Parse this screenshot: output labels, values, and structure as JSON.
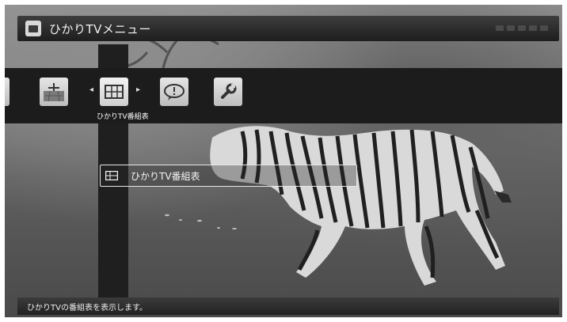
{
  "header": {
    "title": "ひかりTVメニュー",
    "icon": "tv-menu-icon"
  },
  "menu": {
    "items": [
      {
        "icon": "document-icon",
        "selected": false
      },
      {
        "icon": "tv-antenna-icon",
        "selected": false
      },
      {
        "icon": "program-guide-icon",
        "selected": true,
        "label": "ひかりTV番組表"
      },
      {
        "icon": "info-speech-icon",
        "selected": false
      },
      {
        "icon": "wrench-icon",
        "selected": false
      }
    ],
    "arrows": {
      "left": "◂",
      "right": "▸"
    }
  },
  "submenu": {
    "items": [
      {
        "icon": "program-guide-icon",
        "label": "ひかりTV番組表"
      }
    ]
  },
  "status": {
    "text": "ひかりTVの番組表を表示します。"
  },
  "colors": {
    "menu_band": "#1c1c1c",
    "title_bar": "#2a2a2a",
    "text": "#f0f0f0"
  }
}
